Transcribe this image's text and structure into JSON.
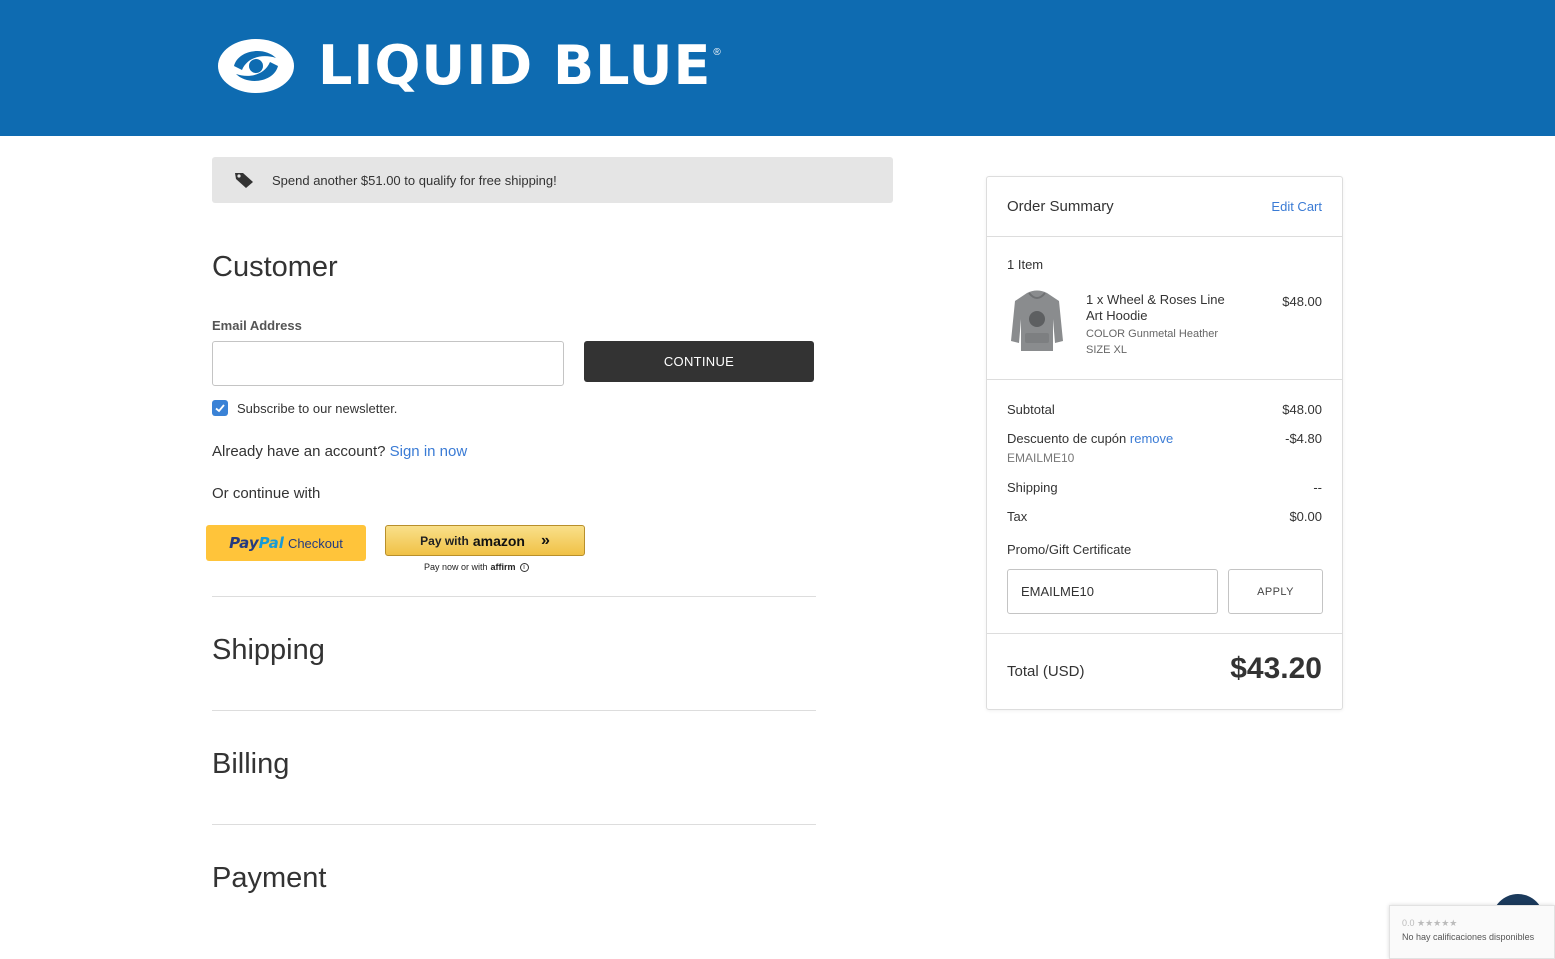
{
  "header": {
    "brand": "LIQUID BLUE",
    "brand_mark": "®",
    "color": "#0e6bb1"
  },
  "banner": {
    "icon": "tag-icon",
    "text": "Spend another $51.00 to qualify for free shipping!"
  },
  "customer": {
    "title": "Customer",
    "email_label": "Email Address",
    "email_value": "",
    "continue_label": "CONTINUE",
    "newsletter_label": "Subscribe to our newsletter.",
    "newsletter_checked": true,
    "account_prompt": "Already have an account?",
    "signin_label": "Sign in now",
    "or_continue": "Or continue with"
  },
  "payment_buttons": {
    "paypal_pay": "Pay",
    "paypal_pal": "Pal",
    "paypal_checkout": "Checkout",
    "amazon_pay": "Pay with",
    "amazon_brand": "amazon",
    "amazon_arrow": "»",
    "affirm_text": "Pay now or with",
    "affirm_brand": "affirm",
    "info_glyph": "i"
  },
  "sections": {
    "shipping": "Shipping",
    "billing": "Billing",
    "payment": "Payment"
  },
  "summary": {
    "title": "Order Summary",
    "edit_cart": "Edit Cart",
    "item_count": "1 Item",
    "item": {
      "name": "1 x Wheel & Roses Line Art Hoodie",
      "price": "$48.00",
      "color": "COLOR Gunmetal Heather",
      "size": "SIZE XL"
    },
    "subtotal_label": "Subtotal",
    "subtotal_value": "$48.00",
    "discount_label": "Descuento de cupón",
    "discount_remove": "remove",
    "discount_value": "-$4.80",
    "coupon_code": "EMAILME10",
    "shipping_label": "Shipping",
    "shipping_value": "--",
    "tax_label": "Tax",
    "tax_value": "$0.00",
    "promo_label": "Promo/Gift Certificate",
    "promo_value": "EMAILME10",
    "apply_label": "APPLY",
    "total_label": "Total (USD)",
    "total_value": "$43.20"
  },
  "reviews_widget": {
    "rating": "0.0 ★★★★★",
    "text": "No hay calificaciones disponibles"
  }
}
